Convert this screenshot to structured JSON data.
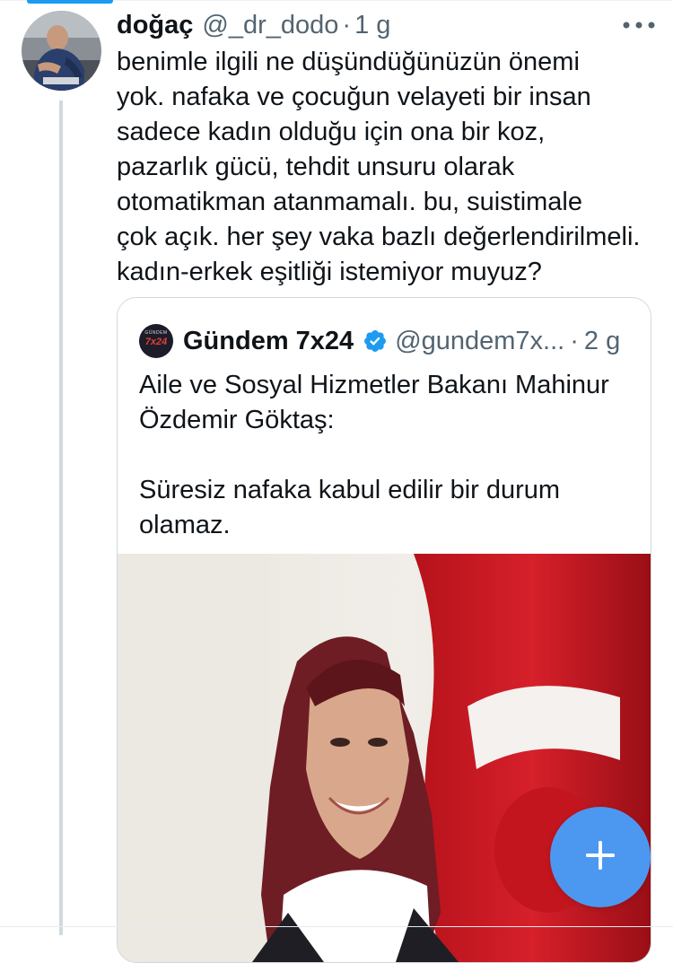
{
  "tweet": {
    "author_name": "doğaç",
    "handle": "@_dr_dodo",
    "separator": "·",
    "time": "1 g",
    "text_lines": [
      "benimle ilgili ne düşündüğünüzün önemi",
      "yok. nafaka ve çocuğun velayeti bir insan",
      "sadece kadın olduğu için ona bir koz,",
      "pazarlık gücü, tehdit unsuru olarak",
      "otomatikman atanmamalı. bu, suistimale",
      "çok açık. her şey vaka bazlı değerlendirilmeli.",
      "kadın-erkek eşitliği istemiyor muyuz?"
    ],
    "avatar_icon": "user-photo",
    "more_icon": "more-horizontal-icon"
  },
  "quoted": {
    "author_name": "Gündem 7x24",
    "handle": "@gundem7x...",
    "separator": "·",
    "time": "2 g",
    "avatar_small_text": "GÜNDEM",
    "avatar_logo": "7x24",
    "text_lines_1": [
      "Aile ve Sosyal Hizmetler Bakanı Mahinur",
      "Özdemir Göktaş:"
    ],
    "text_lines_2": [
      "Süresiz nafaka kabul edilir bir durum",
      "olamaz."
    ],
    "verified_icon": "verified-badge-icon",
    "media": "photo-of-minister-with-turkish-flag"
  },
  "compose_button": {
    "icon": "plus-icon"
  },
  "colors": {
    "accent": "#1d9bf0",
    "fab": "#4c98f0",
    "text_primary": "#0f1419",
    "text_secondary": "#536471",
    "border": "#cfd9de"
  }
}
